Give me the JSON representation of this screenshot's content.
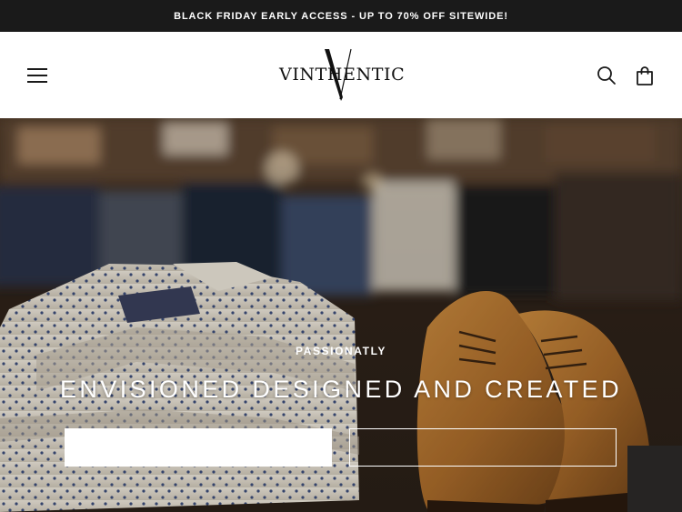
{
  "announcement": {
    "text": "BLACK FRIDAY EARLY ACCESS - UP TO 70% OFF SITEWIDE!"
  },
  "header": {
    "menu_icon": "hamburger-menu-icon",
    "logo_text": "VINTHENTIC",
    "search_icon": "search-icon",
    "cart_icon": "shopping-bag-icon"
  },
  "hero": {
    "subtitle": "PASSIONATLY",
    "title": "ENVISIONED DESIGNED AND CREATED",
    "primary_button_label": "",
    "secondary_button_label": "",
    "image_description_icon": "hero-image"
  },
  "colors": {
    "announcement_bg": "#1a1a1a",
    "header_bg": "#ffffff",
    "text_dark": "#111111",
    "hero_text": "#ffffff"
  }
}
